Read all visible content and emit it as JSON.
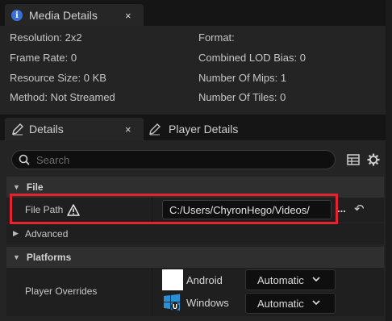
{
  "media_tab": {
    "title": "Media Details",
    "close_glyph": "×"
  },
  "media_stats": {
    "resolution": "Resolution: 2x2",
    "frame_rate": "Frame Rate: 0",
    "resource_size": "Resource Size: 0 KB",
    "method": "Method: Not Streamed",
    "format": "Format:",
    "lod_bias": "Combined LOD Bias: 0",
    "mips": "Number Of Mips: 1",
    "tiles": "Number Of Tiles: 0"
  },
  "details_tabs": [
    {
      "label": "Details",
      "close_glyph": "×"
    },
    {
      "label": "Player Details"
    }
  ],
  "search": {
    "placeholder": "Search"
  },
  "sections": {
    "file": "File",
    "advanced": "Advanced",
    "platforms": "Platforms"
  },
  "file_path": {
    "label": "File Path",
    "value": "C:/Users/ChyronHego/Videos/",
    "browse_glyph": "...",
    "reset_glyph": "↶"
  },
  "player_overrides": {
    "label": "Player Overrides",
    "platforms": [
      {
        "name": "Android",
        "value": "Automatic",
        "icon": "android-platform-icon"
      },
      {
        "name": "Windows",
        "value": "Automatic",
        "icon": "windows-platform-icon"
      }
    ]
  },
  "colors": {
    "highlight": "#e3232f",
    "info_blue": "#3a6fd8"
  }
}
